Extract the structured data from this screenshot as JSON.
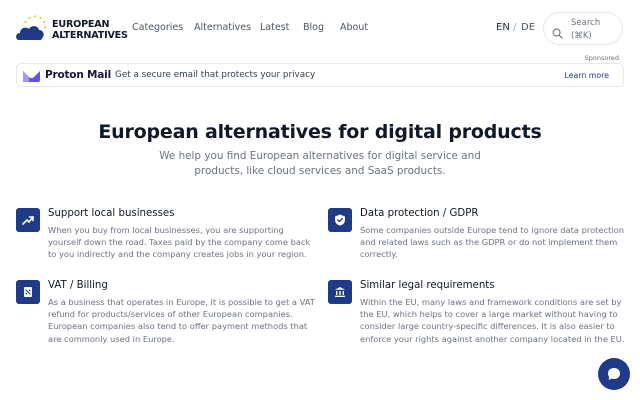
{
  "header": {
    "logo": {
      "line1": "EUROPEAN",
      "line2": "ALTERNATIVES"
    },
    "nav": [
      "Categories",
      "Alternatives",
      "Latest",
      "Blog",
      "About"
    ],
    "lang": {
      "en": "EN",
      "sep": "/",
      "de": "DE"
    },
    "search": {
      "label": "Search\n(⌘K)",
      "icon": "search-icon"
    }
  },
  "ad": {
    "sponsored": "Sponsored",
    "brand": "Proton Mail",
    "text": "Get a secure email that protects your privacy",
    "cta": "Learn more"
  },
  "hero": {
    "title": "European alternatives for digital products",
    "subtitle": "We help you find European alternatives for digital service and products, like cloud services and SaaS products."
  },
  "features": [
    {
      "title": "Support local businesses",
      "icon": "trending-up-icon",
      "desc": "When you buy from local businesses, you are supporting yourself down the road. Taxes paid by the company come back to you indirectly and the company creates jobs in your region."
    },
    {
      "title": "Data protection / GDPR",
      "icon": "shield-icon",
      "desc": "Some companies outside Europe tend to ignore data protection and related laws such as the GDPR or do not implement them correctly."
    },
    {
      "title": "VAT / Billing",
      "icon": "receipt-icon",
      "desc": "As a business that operates in Europe, it is possible to get a VAT refund for products/services of other European companies. European companies also tend to offer payment methods that are commonly used in Europe."
    },
    {
      "title": "Similar legal requirements",
      "icon": "bank-icon",
      "desc": "Within the EU, many laws and framework conditions are set by the EU, which helps to cover a large market without having to consider large country-specific differences. It is also easier to enforce your rights against another company located in the EU."
    }
  ],
  "chat": {
    "icon": "chat-icon"
  },
  "colors": {
    "primary": "#1e3a8a",
    "muted": "#6b7280",
    "proton": "#6d4aff",
    "star": "#facc15"
  }
}
